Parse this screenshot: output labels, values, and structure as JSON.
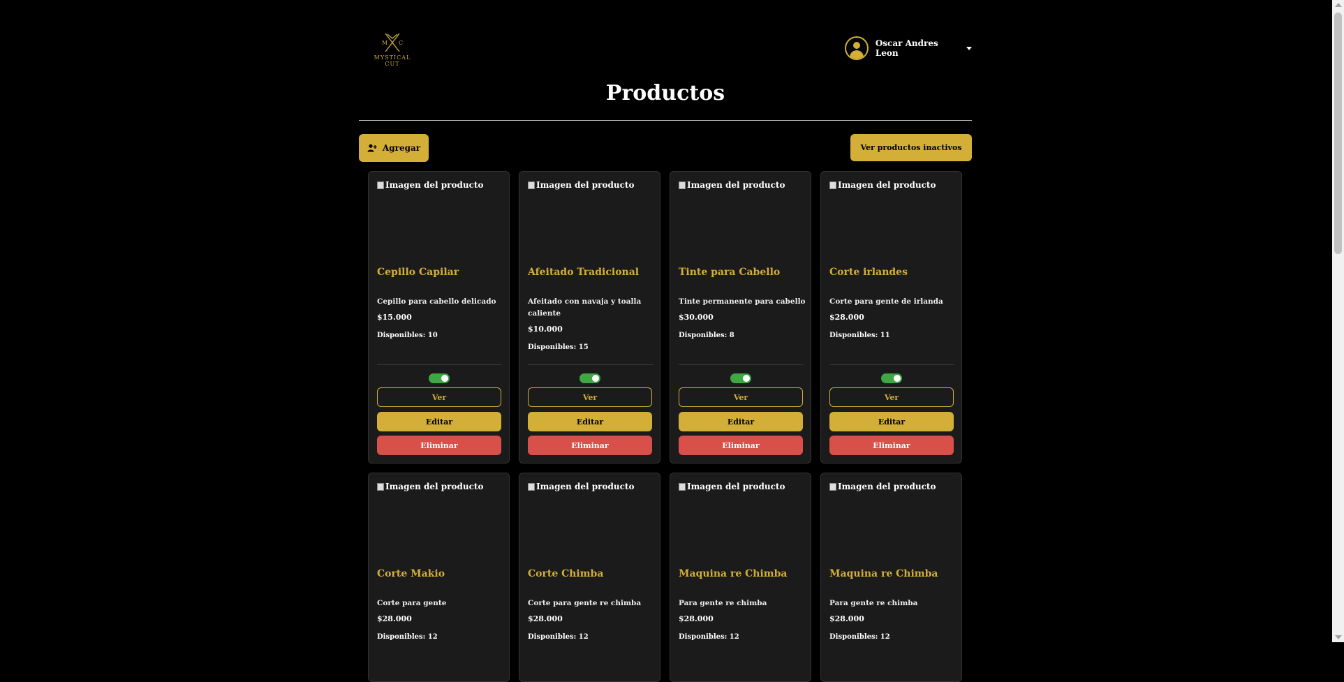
{
  "header": {
    "logo_text_top": "M C",
    "logo_text_1": "MYSTICAL",
    "logo_text_2": "CUT",
    "user_name": "Oscar Andres Leon"
  },
  "page_title": "Productos",
  "toolbar": {
    "add_label": "Agregar",
    "inactive_label": "Ver productos inactivos"
  },
  "image_alt": "Imagen del producto",
  "card_buttons": {
    "view": "Ver",
    "edit": "Editar",
    "delete": "Eliminar"
  },
  "products": [
    {
      "name": "Cepillo Capilar",
      "description": "Cepillo para cabello delicado",
      "price": "$15.000",
      "stock": "Disponibles: 10",
      "active": true
    },
    {
      "name": "Afeitado Tradicional",
      "description": "Afeitado con navaja y toalla caliente",
      "price": "$10.000",
      "stock": "Disponibles: 15",
      "active": true
    },
    {
      "name": "Tinte para Cabello",
      "description": "Tinte permanente para cabello",
      "price": "$30.000",
      "stock": "Disponibles: 8",
      "active": true
    },
    {
      "name": "Corte irlandes",
      "description": "Corte para gente de irlanda",
      "price": "$28.000",
      "stock": "Disponibles: 11",
      "active": true
    },
    {
      "name": "Corte Makio",
      "description": "Corte para gente",
      "price": "$28.000",
      "stock": "Disponibles: 12"
    },
    {
      "name": "Corte Chimba",
      "description": "Corte para gente re chimba",
      "price": "$28.000",
      "stock": "Disponibles: 12"
    },
    {
      "name": "Maquina re Chimba",
      "description": "Para gente re chimba",
      "price": "$28.000",
      "stock": "Disponibles: 12"
    },
    {
      "name": "Maquina re Chimba",
      "description": "Para gente re chimba",
      "price": "$28.000",
      "stock": "Disponibles: 12"
    }
  ],
  "colors": {
    "accent": "#d4af37",
    "danger": "#d9504b",
    "toggle_on": "#3fa845",
    "card_bg": "#1b1b1b"
  }
}
